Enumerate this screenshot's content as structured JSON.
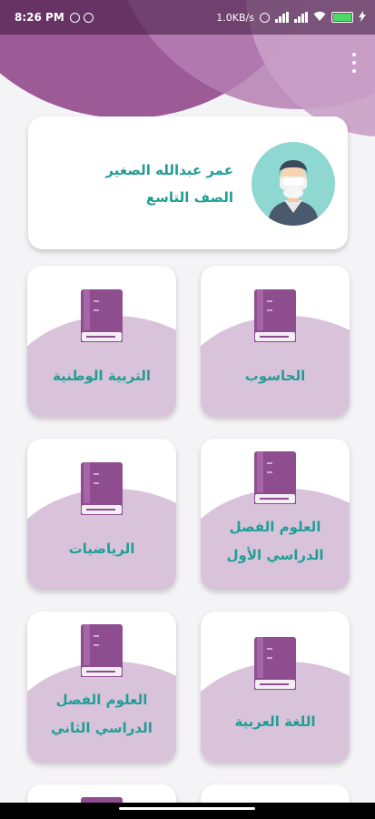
{
  "status_bar": {
    "time": "8:26 PM",
    "network_speed": "1.0KB/s",
    "battery_color": "#4cd964"
  },
  "header": {
    "menu_icon": "more-vert-icon"
  },
  "profile": {
    "name": "عمر عبدالله الصغير",
    "grade": "الصف التاسع"
  },
  "subjects": [
    {
      "label": "الحاسوب"
    },
    {
      "label": "التربية الوطنية"
    },
    {
      "label": "العلوم الفصل الدراسي الأول"
    },
    {
      "label": "الرياضيات"
    },
    {
      "label": "اللغة العربية"
    },
    {
      "label": "العلوم الفصل الدراسي الثاني"
    }
  ],
  "colors": {
    "accent": "#1f9f94",
    "header_purple": "#9c5a97",
    "card_blob": "#d9c3db",
    "book": "#8e4d8f"
  }
}
